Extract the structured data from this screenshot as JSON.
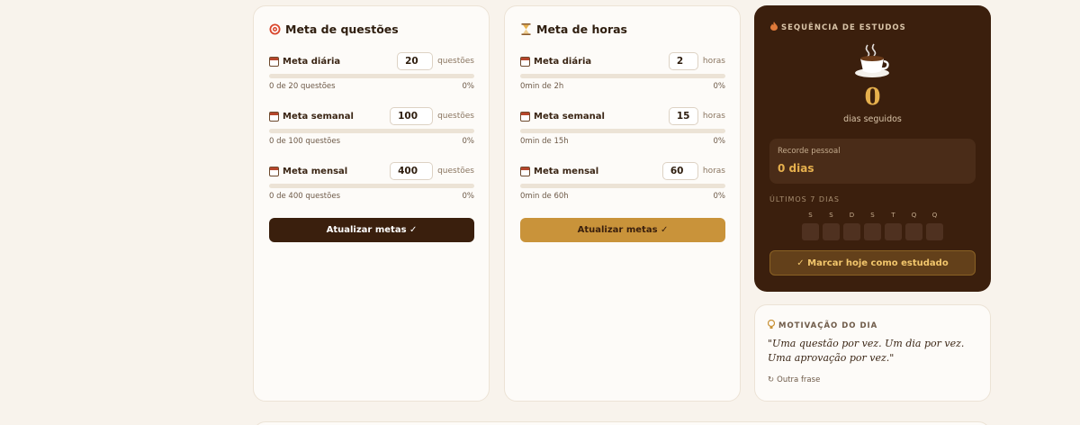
{
  "questions_card": {
    "title": "Meta de questões",
    "icon": "target-icon",
    "goals": [
      {
        "label": "Meta diária",
        "value": "20",
        "unit": "questões",
        "progress_text": "0 de 20 questões",
        "percent": "0%",
        "progress": 0
      },
      {
        "label": "Meta semanal",
        "value": "100",
        "unit": "questões",
        "progress_text": "0 de 100 questões",
        "percent": "0%",
        "progress": 0
      },
      {
        "label": "Meta mensal",
        "value": "400",
        "unit": "questões",
        "progress_text": "0 de 400 questões",
        "percent": "0%",
        "progress": 0
      }
    ],
    "button_label": "Atualizar metas ✓"
  },
  "hours_card": {
    "title": "Meta de horas",
    "icon": "hourglass-icon",
    "goals": [
      {
        "label": "Meta diária",
        "value": "2",
        "unit": "horas",
        "progress_text": "0min de 2h",
        "percent": "0%",
        "progress": 0
      },
      {
        "label": "Meta semanal",
        "value": "15",
        "unit": "horas",
        "progress_text": "0min de 15h",
        "percent": "0%",
        "progress": 0
      },
      {
        "label": "Meta mensal",
        "value": "60",
        "unit": "horas",
        "progress_text": "0min de 60h",
        "percent": "0%",
        "progress": 0
      }
    ],
    "button_label": "Atualizar metas ✓"
  },
  "streak_card": {
    "heading": "SEQUÊNCIA DE ESTUDOS",
    "count": "0",
    "count_label": "dias seguidos",
    "record_label": "Recorde pessoal",
    "record_value": "0 dias",
    "last7_label": "ÚLTIMOS 7 DIAS",
    "days": [
      "S",
      "S",
      "D",
      "S",
      "T",
      "Q",
      "Q"
    ],
    "mark_button": "✓ Marcar hoje como estudado"
  },
  "motivation_card": {
    "heading": "MOTIVAÇÃO DO DIA",
    "quote": "\"Uma questão por vez. Um dia por vez. Uma aprovação por vez.\"",
    "refresh_label": "Outra frase"
  },
  "colors": {
    "background": "#f8f3ec",
    "dark_brown": "#3b1f0d",
    "gold": "#c9933a",
    "streak_number": "#e6b04d"
  }
}
